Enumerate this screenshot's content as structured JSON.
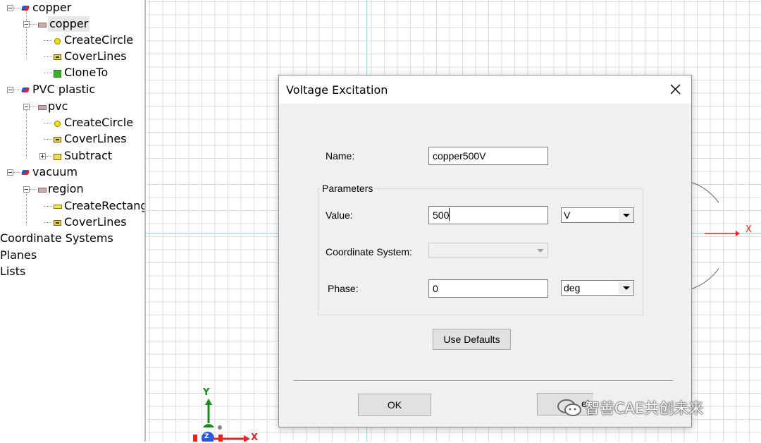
{
  "tree": {
    "items": [
      {
        "label": "copper",
        "icon": "solid-icon"
      },
      {
        "label": "copper",
        "icon": "sheet-icon"
      },
      {
        "label": "CreateCircle",
        "icon": "circle-icon"
      },
      {
        "label": "CoverLines",
        "icon": "cover-lines-icon"
      },
      {
        "label": "CloneTo",
        "icon": "clone-icon"
      },
      {
        "label": "PVC plastic",
        "icon": "solid-icon"
      },
      {
        "label": "pvc",
        "icon": "sheet-icon"
      },
      {
        "label": "CreateCircle",
        "icon": "circle-icon"
      },
      {
        "label": "CoverLines",
        "icon": "cover-lines-icon"
      },
      {
        "label": "Subtract",
        "icon": "subtract-icon"
      },
      {
        "label": "vacuum",
        "icon": "solid-icon"
      },
      {
        "label": "region",
        "icon": "sheet-icon"
      },
      {
        "label": "CreateRectang",
        "icon": "rectangle-icon"
      },
      {
        "label": "CoverLines",
        "icon": "cover-lines-icon"
      },
      {
        "label": "Coordinate Systems"
      },
      {
        "label": "Planes"
      },
      {
        "label": "Lists"
      }
    ]
  },
  "canvas": {
    "x_axis_label": "X",
    "triad": {
      "y": "Y",
      "x": "X",
      "z": "Z"
    }
  },
  "dialog": {
    "title": "Voltage Excitation",
    "name_label": "Name:",
    "name_value": "copper500V",
    "group_label": "Parameters",
    "value_label": "Value:",
    "value_value": "500",
    "value_unit": "V",
    "coord_label": "Coordinate System:",
    "coord_value": "",
    "phase_label": "Phase:",
    "phase_value": "0",
    "phase_unit": "deg",
    "defaults_button": "Use Defaults",
    "ok_button": "OK",
    "cancel_button_partial": "el"
  },
  "watermark": {
    "text": "智善CAE共创未来"
  },
  "colors": {
    "grid": "#dcdcdc",
    "axis": "#9ad9de",
    "x_axis": "#ee2222",
    "y_axis": "#1a8a1a",
    "dialog_bg": "#f0f0f0"
  }
}
